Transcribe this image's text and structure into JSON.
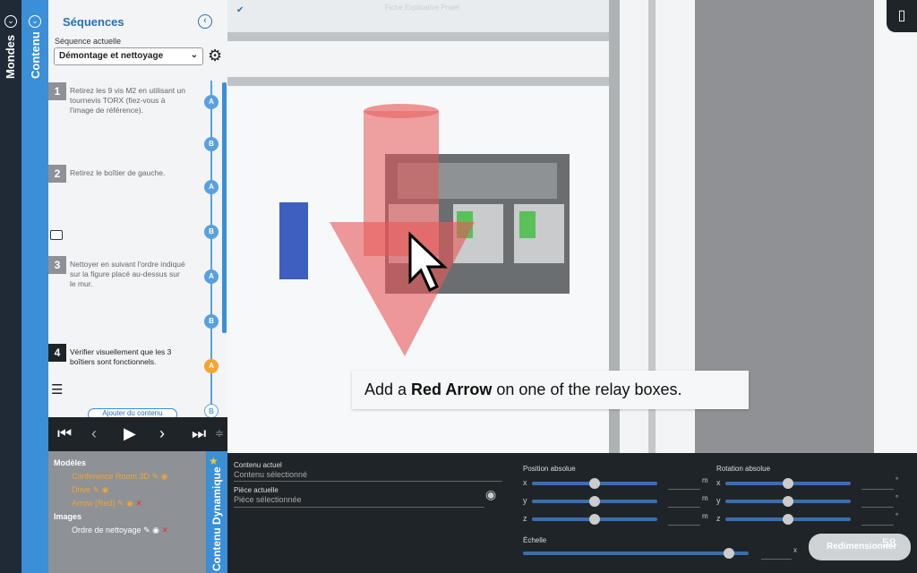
{
  "left_tabs": {
    "mondes": "Mondes",
    "contenu": "Contenu"
  },
  "panel": {
    "title": "Séquences",
    "sequence_label": "Séquence actuelle",
    "sequence_value": "Démontage et nettoyage",
    "add_content": "Ajouter du contenu",
    "steps": [
      {
        "num": "1",
        "text": "Retirez les 9 vis M2 en utilisant un tournevis TORX (fiez-vous à l'image de référence).",
        "state": "done"
      },
      {
        "num": "2",
        "text": "Retirez le boîtier de gauche.",
        "state": "done"
      },
      {
        "num": "3",
        "text": "Nettoyer en suivant l'ordre indiqué sur la figure placé au-dessus sur le mur.",
        "state": "done"
      },
      {
        "num": "4",
        "text": "Vérifier visuellement que les 3 boîtiers sont fonctionnels.",
        "state": "current"
      }
    ],
    "step_dots": [
      "A",
      "B",
      "A",
      "B",
      "A",
      "B",
      "A",
      "B"
    ]
  },
  "models": {
    "models_heading": "Modèles",
    "items": [
      "Conference Room 3D",
      "Drive",
      "Arrow (Red)"
    ],
    "images_heading": "Images",
    "images": [
      "Ordre de nettoyage"
    ],
    "dynamic_label": "Contenu Dynamique"
  },
  "viewport": {
    "instruction_prefix": "Add a ",
    "instruction_bold": "Red Arrow",
    "instruction_suffix": " on one of the relay boxes.",
    "faint_label": "Fiche Explicative Projet"
  },
  "properties": {
    "current_content_label": "Contenu actuel",
    "current_content_value": "Contenu sélectionné",
    "current_piece_label": "Pièce actuelle",
    "current_piece_value": "Pièce sélectionnée",
    "position_label": "Position absolue",
    "rotation_label": "Rotation absolue",
    "scale_label": "Échelle",
    "axes": [
      "x",
      "y",
      "z"
    ],
    "position_unit": "m",
    "rotation_unit": "°",
    "scale_unit": "x",
    "resize_button": "Redimensionner",
    "counter": "58"
  },
  "colors": {
    "accent": "#3a8fd6",
    "dark": "#1f2428",
    "orange": "#f2a531",
    "arrow": "#e85656"
  }
}
